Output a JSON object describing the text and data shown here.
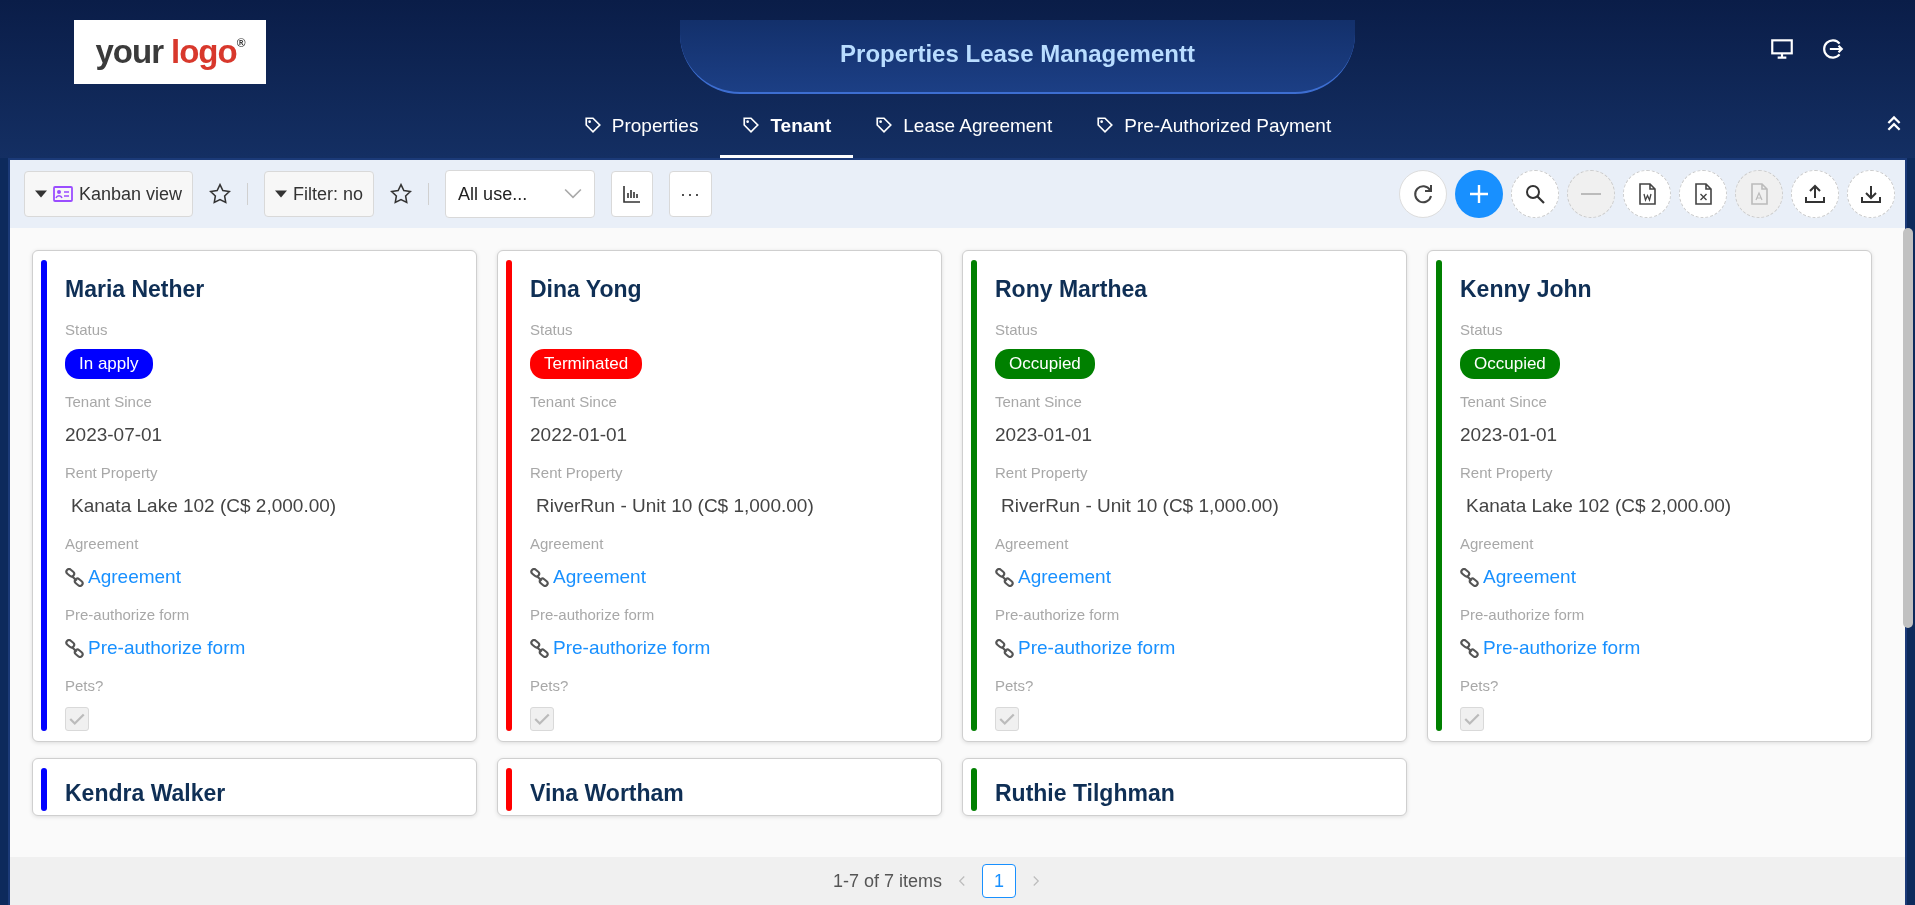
{
  "header": {
    "logo": {
      "word_1": "your",
      "word_2": "logo",
      "mark": "®"
    },
    "title": "Properties Lease Managementt"
  },
  "tabs": [
    {
      "label": "Properties",
      "selected": false
    },
    {
      "label": "Tenant",
      "selected": true
    },
    {
      "label": "Lease Agreement",
      "selected": false
    },
    {
      "label": "Pre-Authorized Payment",
      "selected": false
    }
  ],
  "toolbar": {
    "view_button": "Kanban view",
    "filter_button": "Filter: no",
    "user_select": "All use...",
    "more_button": "···",
    "tools": [
      {
        "kind": "refresh",
        "disabled": false
      },
      {
        "kind": "add",
        "disabled": false
      },
      {
        "kind": "search",
        "disabled": false
      },
      {
        "kind": "remove",
        "disabled": true
      },
      {
        "kind": "word",
        "disabled": false
      },
      {
        "kind": "excel",
        "disabled": false
      },
      {
        "kind": "pdf",
        "disabled": true
      },
      {
        "kind": "upload",
        "disabled": false
      },
      {
        "kind": "download",
        "disabled": false
      }
    ]
  },
  "cards": [
    {
      "name": "Maria Nether",
      "color": "#0000ff",
      "status_label": "Status",
      "status": "In apply",
      "since_label": "Tenant Since",
      "since": "2023-07-01",
      "property_label": "Rent Property",
      "property": "Kanata Lake 102 (C$ 2,000.00)",
      "agreement_label": "Agreement",
      "agreement_link": "Agreement",
      "preauth_label": "Pre-authorize form",
      "preauth_link": "Pre-authorize form",
      "pets_label": "Pets?",
      "pets_checked": true
    },
    {
      "name": "Dina Yong",
      "color": "#ff0000",
      "status_label": "Status",
      "status": "Terminated",
      "since_label": "Tenant Since",
      "since": "2022-01-01",
      "property_label": "Rent Property",
      "property": "RiverRun - Unit 10 (C$ 1,000.00)",
      "agreement_label": "Agreement",
      "agreement_link": "Agreement",
      "preauth_label": "Pre-authorize form",
      "preauth_link": "Pre-authorize form",
      "pets_label": "Pets?",
      "pets_checked": true
    },
    {
      "name": "Rony Marthea",
      "color": "#008000",
      "status_label": "Status",
      "status": "Occupied",
      "since_label": "Tenant Since",
      "since": "2023-01-01",
      "property_label": "Rent Property",
      "property": "RiverRun - Unit 10 (C$ 1,000.00)",
      "agreement_label": "Agreement",
      "agreement_link": "Agreement",
      "preauth_label": "Pre-authorize form",
      "preauth_link": "Pre-authorize form",
      "pets_label": "Pets?",
      "pets_checked": true
    },
    {
      "name": "Kenny John",
      "color": "#008000",
      "status_label": "Status",
      "status": "Occupied",
      "since_label": "Tenant Since",
      "since": "2023-01-01",
      "property_label": "Rent Property",
      "property": "Kanata Lake 102 (C$ 2,000.00)",
      "agreement_label": "Agreement",
      "agreement_link": "Agreement",
      "preauth_label": "Pre-authorize form",
      "preauth_link": "Pre-authorize form",
      "pets_label": "Pets?",
      "pets_checked": true
    }
  ],
  "partial_cards": [
    {
      "name": "Kendra Walker",
      "color": "#0000ff"
    },
    {
      "name": "Vina Wortham",
      "color": "#ff0000"
    },
    {
      "name": "Ruthie Tilghman",
      "color": "#008000"
    }
  ],
  "pagination": {
    "summary": "1-7 of 7 items",
    "pages": [
      {
        "label": "1",
        "selected": true
      }
    ]
  }
}
